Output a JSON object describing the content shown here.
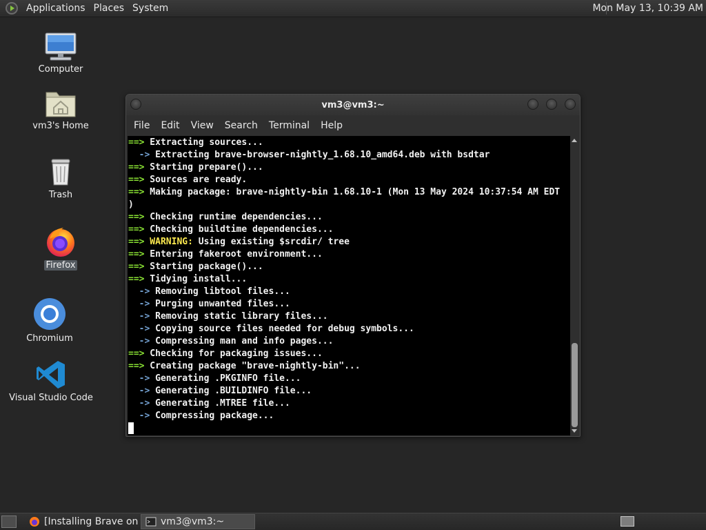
{
  "top_panel": {
    "menus": [
      "Applications",
      "Places",
      "System"
    ],
    "clock": "Mon May 13, 10:39 AM"
  },
  "desktop_icons": [
    {
      "label": "Computer",
      "icon": "computer-icon"
    },
    {
      "label": "vm3's Home",
      "icon": "home-folder-icon"
    },
    {
      "label": "Trash",
      "icon": "trash-icon"
    },
    {
      "label": "Firefox",
      "icon": "firefox-icon"
    },
    {
      "label": "Chromium",
      "icon": "chromium-icon"
    },
    {
      "label": "Visual Studio Code",
      "icon": "vscode-icon"
    }
  ],
  "terminal": {
    "title": "vm3@vm3:~",
    "menu": [
      "File",
      "Edit",
      "View",
      "Search",
      "Terminal",
      "Help"
    ],
    "lines": [
      {
        "prefix": "==>",
        "kind": "main",
        "text": " Extracting sources..."
      },
      {
        "prefix": "  ->",
        "kind": "sub",
        "text": " Extracting brave-browser-nightly_1.68.10_amd64.deb with bsdtar"
      },
      {
        "prefix": "==>",
        "kind": "main",
        "text": " Starting prepare()..."
      },
      {
        "prefix": "==>",
        "kind": "main",
        "text": " Sources are ready."
      },
      {
        "prefix": "==>",
        "kind": "main",
        "text": " Making package: brave-nightly-bin 1.68.10-1 (Mon 13 May 2024 10:37:54 AM EDT"
      },
      {
        "prefix": "",
        "kind": "plain",
        "text": ")"
      },
      {
        "prefix": "==>",
        "kind": "main",
        "text": " Checking runtime dependencies..."
      },
      {
        "prefix": "==>",
        "kind": "main",
        "text": " Checking buildtime dependencies..."
      },
      {
        "prefix": "==>",
        "kind": "warn",
        "label": " WARNING:",
        "text": " Using existing $srcdir/ tree"
      },
      {
        "prefix": "==>",
        "kind": "main",
        "text": " Entering fakeroot environment..."
      },
      {
        "prefix": "==>",
        "kind": "main",
        "text": " Starting package()..."
      },
      {
        "prefix": "==>",
        "kind": "main",
        "text": " Tidying install..."
      },
      {
        "prefix": "  ->",
        "kind": "sub",
        "text": " Removing libtool files..."
      },
      {
        "prefix": "  ->",
        "kind": "sub",
        "text": " Purging unwanted files..."
      },
      {
        "prefix": "  ->",
        "kind": "sub",
        "text": " Removing static library files..."
      },
      {
        "prefix": "  ->",
        "kind": "sub",
        "text": " Copying source files needed for debug symbols..."
      },
      {
        "prefix": "  ->",
        "kind": "sub",
        "text": " Compressing man and info pages..."
      },
      {
        "prefix": "==>",
        "kind": "main",
        "text": " Checking for packaging issues..."
      },
      {
        "prefix": "==>",
        "kind": "main",
        "text": " Creating package \"brave-nightly-bin\"..."
      },
      {
        "prefix": "  ->",
        "kind": "sub",
        "text": " Generating .PKGINFO file..."
      },
      {
        "prefix": "  ->",
        "kind": "sub",
        "text": " Generating .BUILDINFO file..."
      },
      {
        "prefix": "  ->",
        "kind": "sub",
        "text": " Generating .MTREE file..."
      },
      {
        "prefix": "  ->",
        "kind": "sub",
        "text": " Compressing package..."
      }
    ]
  },
  "taskbar": {
    "tasks": [
      {
        "label": "[Installing Brave on ...",
        "icon": "firefox-icon",
        "active": false
      },
      {
        "label": "vm3@vm3:~",
        "icon": "terminal-icon",
        "active": true
      }
    ]
  },
  "colors": {
    "arrow_main": "#8ae234",
    "arrow_sub": "#729fcf",
    "warning": "#fce94f",
    "terminal_bg": "#000000"
  }
}
